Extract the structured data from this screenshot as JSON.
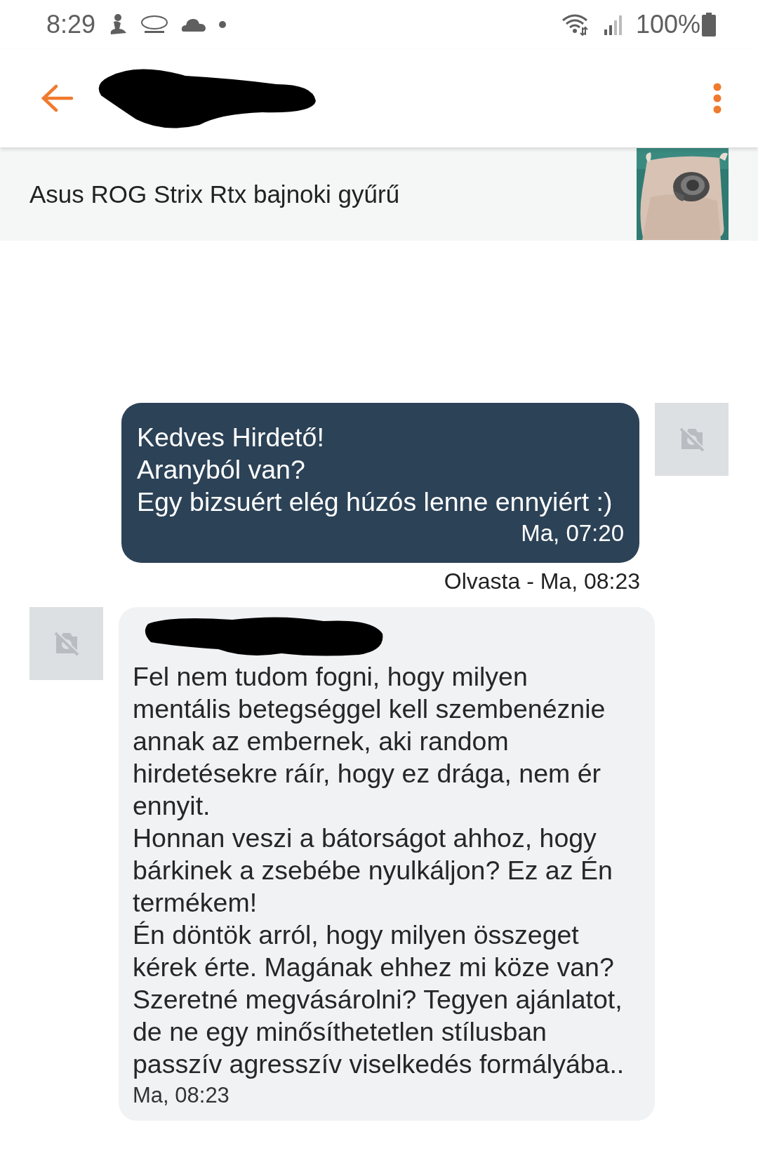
{
  "status_bar": {
    "time": "8:29",
    "battery": "100%"
  },
  "header": {
    "name_redacted": true
  },
  "listing": {
    "title": "Asus ROG Strix Rtx bajnoki gyűrű"
  },
  "messages": [
    {
      "kind": "sent",
      "text": "Kedves Hirdető!\nAranyból van?\nEgy bizsuért elég húzós lenne ennyiért :)",
      "time": "Ma, 07:20",
      "receipt": "Olvasta - Ma, 08:23"
    },
    {
      "kind": "received",
      "opening_redacted": true,
      "text": "Fel nem tudom fogni, hogy milyen\nmentális betegséggel kell szembenéznie\nannak az embernek, aki random\nhirdetésekre ráír, hogy ez drága, nem ér\nennyit.\nHonnan veszi a bátorságot ahhoz, hogy\nbárkinek a zsebébe nyulkáljon? Ez az Én\ntermékem!\nÉn döntök arról, hogy milyen összeget\nkérek érte. Magának ehhez mi köze van?\nSzeretné megvásárolni? Tegyen ajánlatot,\nde ne egy minősíthetetlen stílusban\npasszív agresszív viselkedés formályába..",
      "time": "Ma, 08:23"
    }
  ]
}
